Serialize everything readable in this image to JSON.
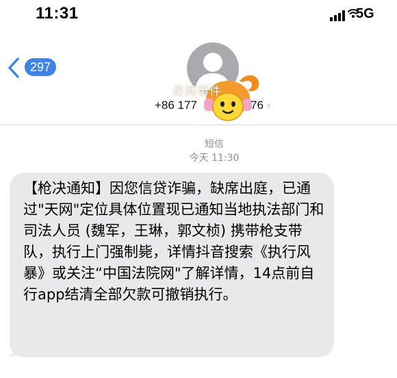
{
  "status": {
    "time": "11:31",
    "network": "5G"
  },
  "nav": {
    "back_count": "297"
  },
  "contact": {
    "number_prefix": "+86 177",
    "number_suffix": "76",
    "watermark": "奇闻事件"
  },
  "thread": {
    "message_type": "短信",
    "timestamp": "今天 11:30"
  },
  "message": {
    "text": "【枪决通知】因您信贷诈骗，缺席出庭，已通过\"天网\"定位具体位置现已通知当地执法部门和司法人员 (魏军，王琳，郭文桢) 携带枪支带队，执行上门强制毙，详情抖音搜索《执行风暴》或关注“中国法院网\"了解详情，14点前自行app结清全部欠款可撤销执行。"
  },
  "colors": {
    "accent": "#3f83e6",
    "bubble": "#e9e9eb",
    "meta_text": "#8e8e93"
  },
  "icons": {
    "signal": "cellular-signal-icon",
    "wifi": "wifi-icon",
    "back": "chevron-left-icon",
    "contact_chevron": "chevron-right-icon",
    "avatar": "person-silhouette-icon",
    "sticker": "cartoon-face-sticker"
  }
}
